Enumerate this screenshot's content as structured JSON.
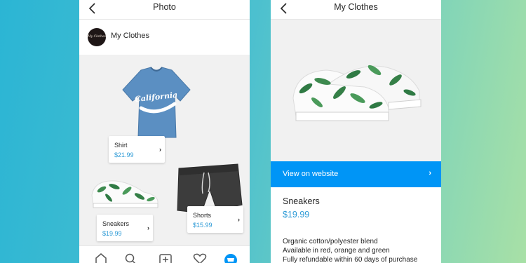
{
  "left_screen": {
    "header": {
      "title": "Photo"
    },
    "profile": {
      "name": "My Clothes",
      "avatar_text": "My Clothes"
    },
    "shirt_graphic_text": "California",
    "tags": [
      {
        "name": "Shirt",
        "price": "$21.99"
      },
      {
        "name": "Sneakers",
        "price": "$19.99"
      },
      {
        "name": "Shorts",
        "price": "$15.99"
      }
    ],
    "tabbar": [
      "home-icon",
      "search-icon",
      "add-post-icon",
      "heart-icon",
      "shop-icon"
    ]
  },
  "right_screen": {
    "header": {
      "title": "My Clothes"
    },
    "view_on_website": "View on website",
    "product": {
      "name": "Sneakers",
      "price": "$19.99",
      "description": [
        "Organic cotton/polyester blend",
        "Available in red, orange and green",
        "Fully refundable within 60 days of purchase"
      ]
    }
  },
  "colors": {
    "link_blue": "#0095f6",
    "price_blue": "#2c9ad6",
    "background_gradient_start": "#2bb5d4",
    "background_gradient_end": "#a8e0a6"
  }
}
